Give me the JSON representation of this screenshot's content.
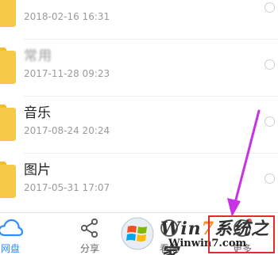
{
  "files": [
    {
      "name": "",
      "date": "2018-02-16  16:31",
      "name_obscured": true
    },
    {
      "name": "常用",
      "date": "2017-11-28  09:23",
      "name_obscured": true
    },
    {
      "name": "音乐",
      "date": "2017-08-24  20:24",
      "name_obscured": false
    },
    {
      "name": "图片",
      "date": "2017-05-31  17:07",
      "name_obscured": false
    }
  ],
  "bottom_nav": [
    {
      "label": "网盘",
      "icon": "cloud-icon",
      "active": true
    },
    {
      "label": "分享",
      "icon": "share-icon",
      "active": false
    },
    {
      "label": "看吧",
      "icon": "compass-icon",
      "active": false
    },
    {
      "label": "更多",
      "icon": "more-icon",
      "active": false
    }
  ],
  "watermark": {
    "title_prefix": "Win",
    "title_seven": "7",
    "title_suffix": "系统之家",
    "url": "Winwin7.com"
  },
  "colors": {
    "folder": "#f7c948",
    "active_nav": "#2f8cff",
    "annotation_box": "#e42a2a",
    "annotation_arrow": "#c832e6"
  }
}
